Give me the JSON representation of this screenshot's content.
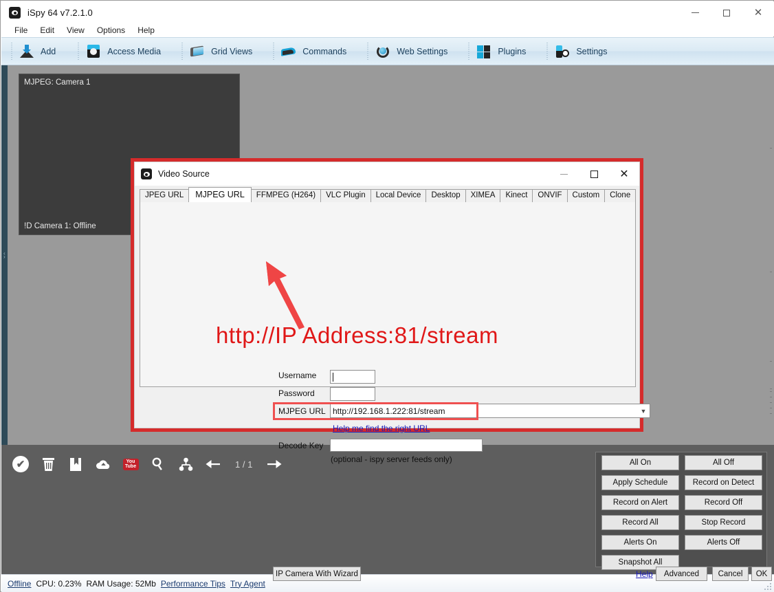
{
  "window": {
    "title": "iSpy 64 v7.2.1.0",
    "icon": "eye-icon",
    "controls": {
      "minimize": "–",
      "maximize": "▢",
      "close": "✕"
    }
  },
  "menubar": {
    "items": [
      "File",
      "Edit",
      "View",
      "Options",
      "Help"
    ]
  },
  "toolbar": {
    "items": [
      {
        "label": "Add",
        "icon": "add-icon"
      },
      {
        "label": "Access Media",
        "icon": "media-icon"
      },
      {
        "label": "Grid Views",
        "icon": "grid-views-icon"
      },
      {
        "label": "Commands",
        "icon": "commands-icon"
      },
      {
        "label": "Web Settings",
        "icon": "web-settings-icon"
      },
      {
        "label": "Plugins",
        "icon": "plugins-icon"
      },
      {
        "label": "Settings",
        "icon": "settings-icon"
      }
    ]
  },
  "camera_panel": {
    "header": "MJPEG: Camera 1",
    "footer": "!D Camera 1: Offline"
  },
  "bottom_toolbar": {
    "icons": [
      "check-circle-icon",
      "trash-icon",
      "bookmark-icon",
      "cloud-upload-icon",
      "youtube-icon",
      "search-icon",
      "share-nodes-icon",
      "arrow-left-icon"
    ],
    "page_indicator": "1 / 1",
    "next_icon": "arrow-right-icon",
    "youtube_line1": "You",
    "youtube_line2": "Tube"
  },
  "quick_panel": {
    "buttons": [
      "All On",
      "All Off",
      "Apply Schedule",
      "Record on Detect",
      "Record on Alert",
      "Record Off",
      "Record All",
      "Stop Record",
      "Alerts On",
      "Alerts Off",
      "Snapshot All"
    ]
  },
  "statusbar": {
    "offline": "Offline",
    "cpu": "CPU: 0.23%",
    "ram": "RAM Usage: 52Mb",
    "performance_tips": "Performance Tips",
    "try_agent": "Try Agent"
  },
  "dialog": {
    "title": "Video Source",
    "icon": "eye-icon",
    "controls": {
      "minimize": "–",
      "maximize": "▢",
      "close": "✕"
    },
    "tabs": [
      "JPEG URL",
      "MJPEG URL",
      "FFMPEG (H264)",
      "VLC Plugin",
      "Local Device",
      "Desktop",
      "XIMEA",
      "Kinect",
      "ONVIF",
      "Custom",
      "Clone"
    ],
    "active_tab": "MJPEG URL",
    "fields": {
      "username_label": "Username",
      "username_value": "",
      "password_label": "Password",
      "password_value": "",
      "mjpeg_url_label": "MJPEG URL",
      "mjpeg_url_value": "http://192.168.1.222:81/stream",
      "help_link": "Help me find the right URL",
      "decode_key_label": "Decode Key",
      "decode_key_value": "",
      "decode_key_hint": "(optional - ispy server feeds only)"
    },
    "footer": {
      "wizard": "IP Camera With Wizard",
      "help": "Help",
      "advanced": "Advanced",
      "cancel": "Cancel",
      "ok": "OK"
    }
  },
  "annotation": {
    "text": "http://IP Address:81/stream",
    "color": "#e01818",
    "arrow": "red-arrow-icon",
    "highlight_color": "#ef5050",
    "border_color": "#d52b2b"
  }
}
